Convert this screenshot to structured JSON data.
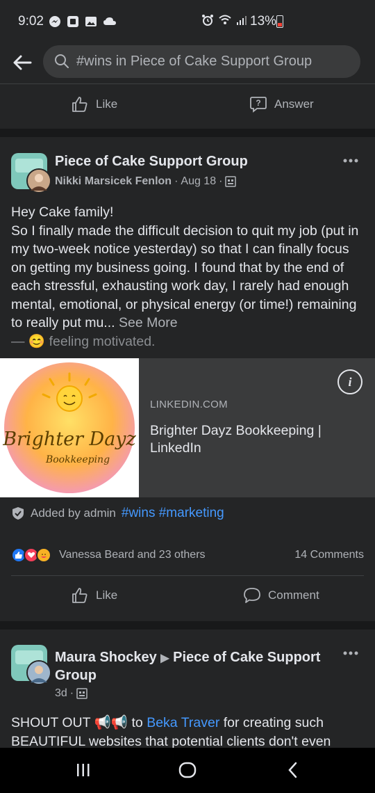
{
  "status_bar": {
    "time": "9:02",
    "battery": "13%"
  },
  "search": {
    "query": "#wins in Piece of Cake Support Group"
  },
  "prev_post_actions": {
    "like": "Like",
    "answer": "Answer"
  },
  "post1": {
    "group": "Piece of Cake Support Group",
    "author": "Nikki Marsicek Fenlon",
    "date": "Aug 18",
    "separator": "·",
    "body_line1": "Hey Cake family!",
    "body_line2": "So I finally made the difficult decision to quit my job (put in my two-week notice yesterday) so that I can finally focus on getting my business going. I found that by the end of each stressful, exhausting work day, I rarely had enough mental, emotional, or physical energy (or time!) remaining to really put mu...",
    "see_more": "See More",
    "feeling": "— 😊 feeling motivated.",
    "link": {
      "domain": "LINKEDIN.COM",
      "title": "Brighter Dayz Bookkeeping | LinkedIn",
      "logo_text_1": "Brighter Dayz",
      "logo_text_2": "Bookkeeping"
    },
    "added_by": "Added by admin",
    "tags": "#wins #marketing",
    "reactions_names": "Vanessa Beard and 23 others",
    "comments": "14 Comments",
    "like": "Like",
    "comment": "Comment"
  },
  "post2": {
    "author": "Maura Shockey",
    "arrow": "▶",
    "group_line1": "Piece of Cake Support",
    "group_line2": "Group",
    "date": "3d",
    "separator": "·",
    "body_prefix": "SHOUT OUT 📢📢 to ",
    "mention": "Beka Traver",
    "body_suffix": " for creating such BEAUTIFUL websites that potential clients don't even"
  },
  "colors": {
    "background": "#18191a",
    "card": "#242526",
    "link": "#4599ff"
  }
}
